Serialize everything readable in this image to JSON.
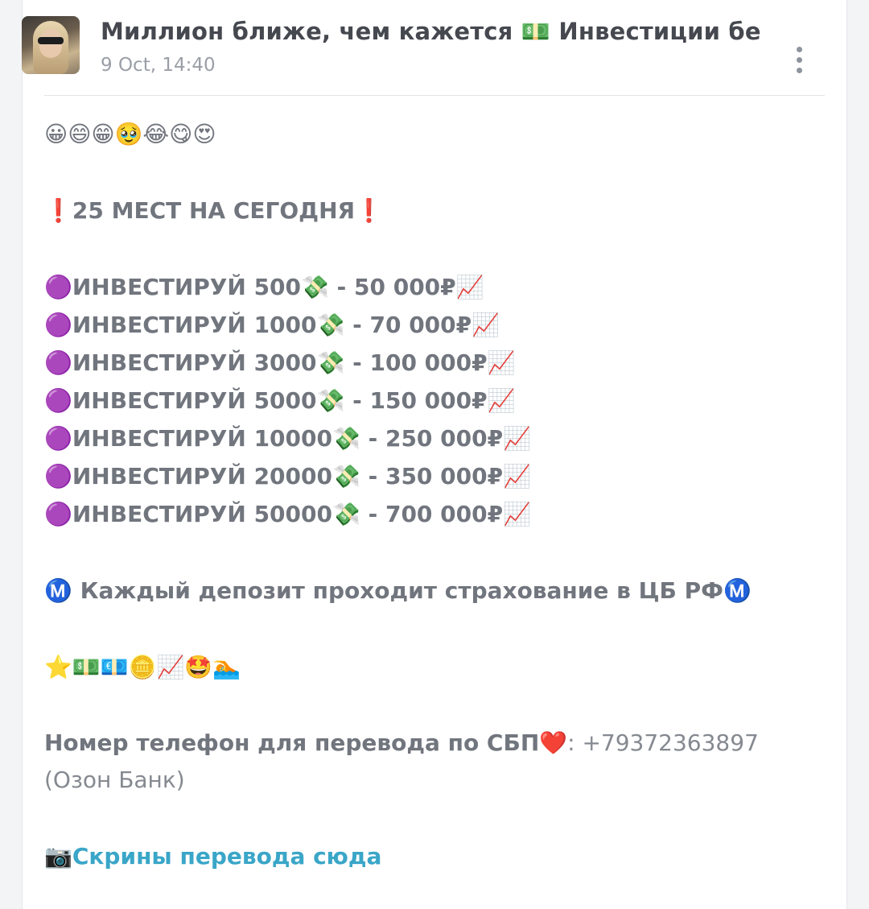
{
  "header": {
    "channel_title": "Миллион ближе, чем кажется 💵 Инвестиции без ли",
    "timestamp": "9 Oct, 14:40",
    "menu_icon": "more-vertical-icon"
  },
  "post": {
    "emoji_row_1": "😀😄😁🥹😂😋😍",
    "headline": "❗25 МЕСТ НА СЕГОДНЯ❗",
    "offers": [
      "🟣ИНВЕСТИРУЙ 500💸 - 50 000₽📈",
      "🟣ИНВЕСТИРУЙ 1000💸 - 70 000₽📈",
      "🟣ИНВЕСТИРУЙ 3000💸 - 100 000₽📈",
      "🟣ИНВЕСТИРУЙ 5000💸 - 150 000₽📈",
      "🟣ИНВЕСТИРУЙ 10000💸 - 250 000₽📈",
      "🟣ИНВЕСТИРУЙ 20000💸 - 350 000₽📈",
      "🟣ИНВЕСТИРУЙ 50000💸 - 700 000₽📈"
    ],
    "insurance_note": "Ⓜ️ Каждый депозит проходит страхование в ЦБ РФⓂ️",
    "emoji_row_2": "⭐💵💶🪙📈🤩🏊",
    "phone_label": "Номер телефон для перевода по СБП❤️",
    "phone_value": ": +79372363897 (Озон Банк)",
    "screens_icon": "📷",
    "screens_link": "Скрины перевода сюда"
  },
  "colors": {
    "text": "#71757d",
    "link": "#3aa6c8",
    "timestamp": "#9a9ea6"
  }
}
